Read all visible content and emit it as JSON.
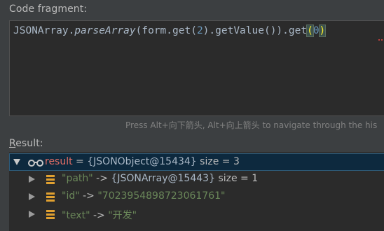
{
  "labels": {
    "code_fragment": "Code fragment:",
    "result_mnemonic": "R",
    "result_rest": "esult:"
  },
  "code": {
    "t1": "JSONArray.",
    "t2": "parseArray",
    "t3": "(form.get(",
    "t4": "2",
    "t5": ").getValue()).get",
    "t6": "(",
    "t7": "0",
    "t8": ")"
  },
  "hint": "Press Alt+向下箭头, Alt+向上箭头 to navigate through the his",
  "tree": {
    "root": {
      "name": "result",
      "sep": " = ",
      "value": "{JSONObject@15434}",
      "size": "size = 3"
    },
    "children": [
      {
        "key": "\"path\"",
        "arrow": " -> ",
        "value": "{JSONArray@15443}",
        "size": "size = 1"
      },
      {
        "key": "\"id\"",
        "arrow": " -> ",
        "value": "\"7023954898723061761\"",
        "size": ""
      },
      {
        "key": "\"text\"",
        "arrow": " -> ",
        "value": "\"开发\"",
        "size": ""
      }
    ]
  },
  "colors": {
    "background": "#3c3f41",
    "editor_bg": "#2b2b2b",
    "selection": "#0d293e",
    "variable": "#e06c64",
    "string": "#6a8759",
    "number": "#6897bb",
    "field_icon": "#e0a030"
  },
  "icons": [
    "watch-glasses-icon",
    "field-icon",
    "expand-arrow-icon",
    "collapse-arrow-icon"
  ]
}
